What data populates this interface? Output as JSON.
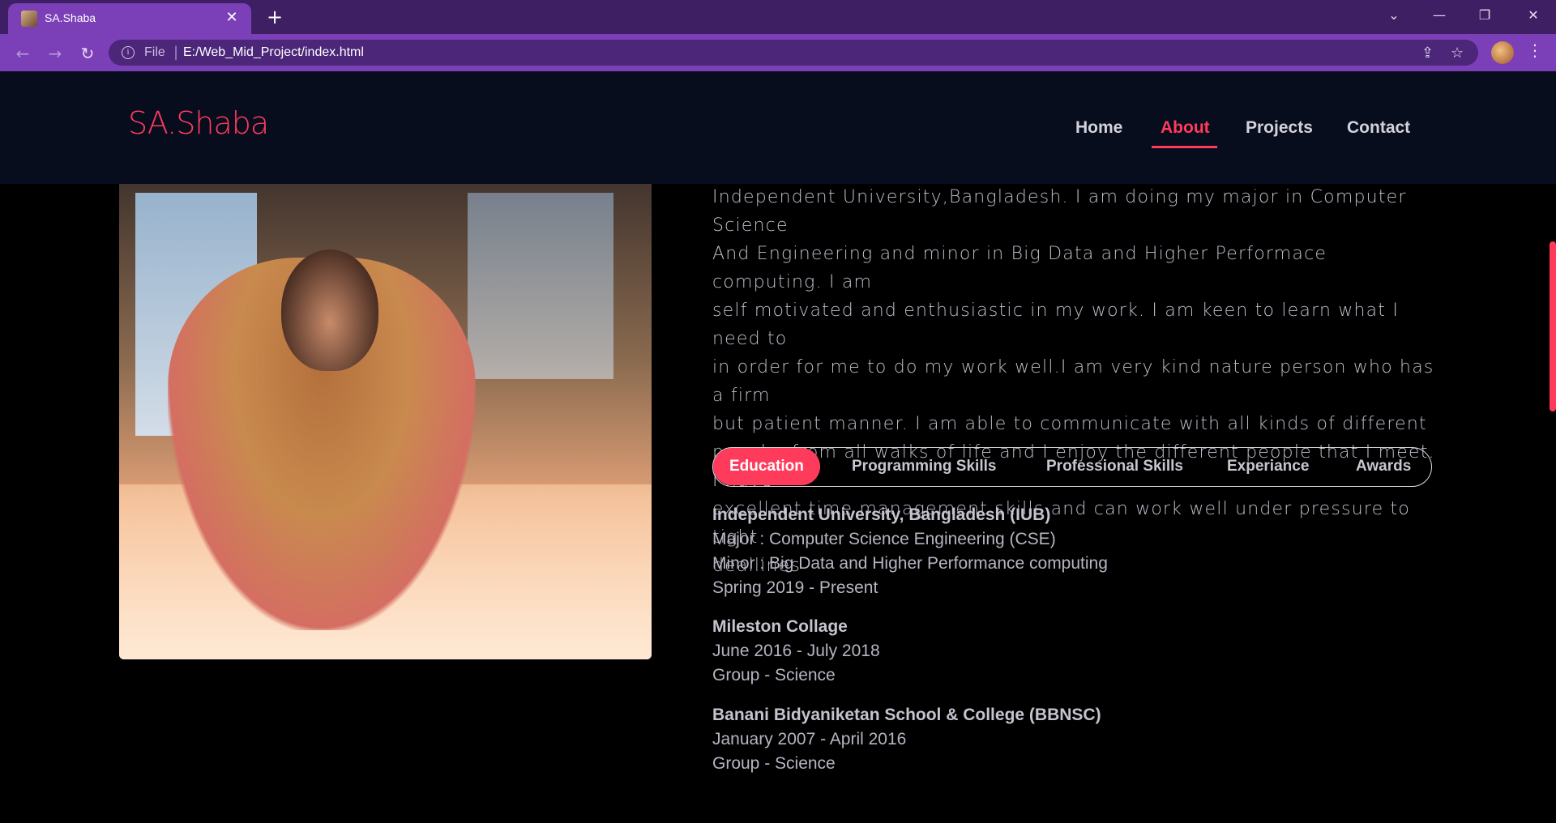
{
  "browser": {
    "tab_title": "SA.Shaba",
    "tab_close": "✕",
    "new_tab": "+",
    "address_scheme": "File",
    "address_separator": "|",
    "address_url": "E:/Web_Mid_Project/index.html",
    "controls": {
      "dropdown": "⌄",
      "minimize": "—",
      "restore": "❐",
      "close": "✕"
    },
    "nav": {
      "back": "←",
      "forward": "→",
      "reload": "↻",
      "info": "i",
      "share": "⇪",
      "star": "☆",
      "menu": "⋮"
    }
  },
  "site": {
    "logo": "SA.Shaba",
    "nav": [
      {
        "label": "Home",
        "active": false
      },
      {
        "label": "About",
        "active": true
      },
      {
        "label": "Projects",
        "active": false
      },
      {
        "label": "Contact",
        "active": false
      }
    ],
    "bio_lines": [
      "Independent University,Bangladesh. I am doing my major in Computer Science",
      "And Engineering and minor in Big Data and Higher Performace computing. I am",
      "self motivated and enthusiastic in my work. I am keen to learn what I need to",
      "in order for me to do my work well.I am very kind nature person who has a firm",
      "but patient manner. I am able to communicate with all kinds of different",
      "people, from all walks of life and I enjoy the different people that I meet. I have",
      "excellent time management skills and can work well under pressure to tight",
      "deallines"
    ],
    "tabs": [
      "Education",
      "Programming Skills",
      "Professional Skills",
      "Experiance",
      "Awards"
    ],
    "active_tab": "Education",
    "education": [
      {
        "school": "Independent University, Bangladesh (IUB)",
        "lines": [
          "Major : Computer Science Engineering (CSE)",
          "Minor : Big Data and Higher Performance computing",
          "Spring 2019 - Present"
        ]
      },
      {
        "school": "Mileston Collage",
        "lines": [
          "June 2016 - July 2018",
          "Group - Science"
        ]
      },
      {
        "school": "Banani Bidyaniketan School & College (BBNSC)",
        "lines": [
          "January 2007 - April 2016",
          "Group - Science"
        ]
      }
    ],
    "colors": {
      "accent": "#ff3b5c",
      "header_bg": "#080d1e",
      "page_bg": "#000000",
      "browser_frame": "#7b3fb8"
    }
  }
}
